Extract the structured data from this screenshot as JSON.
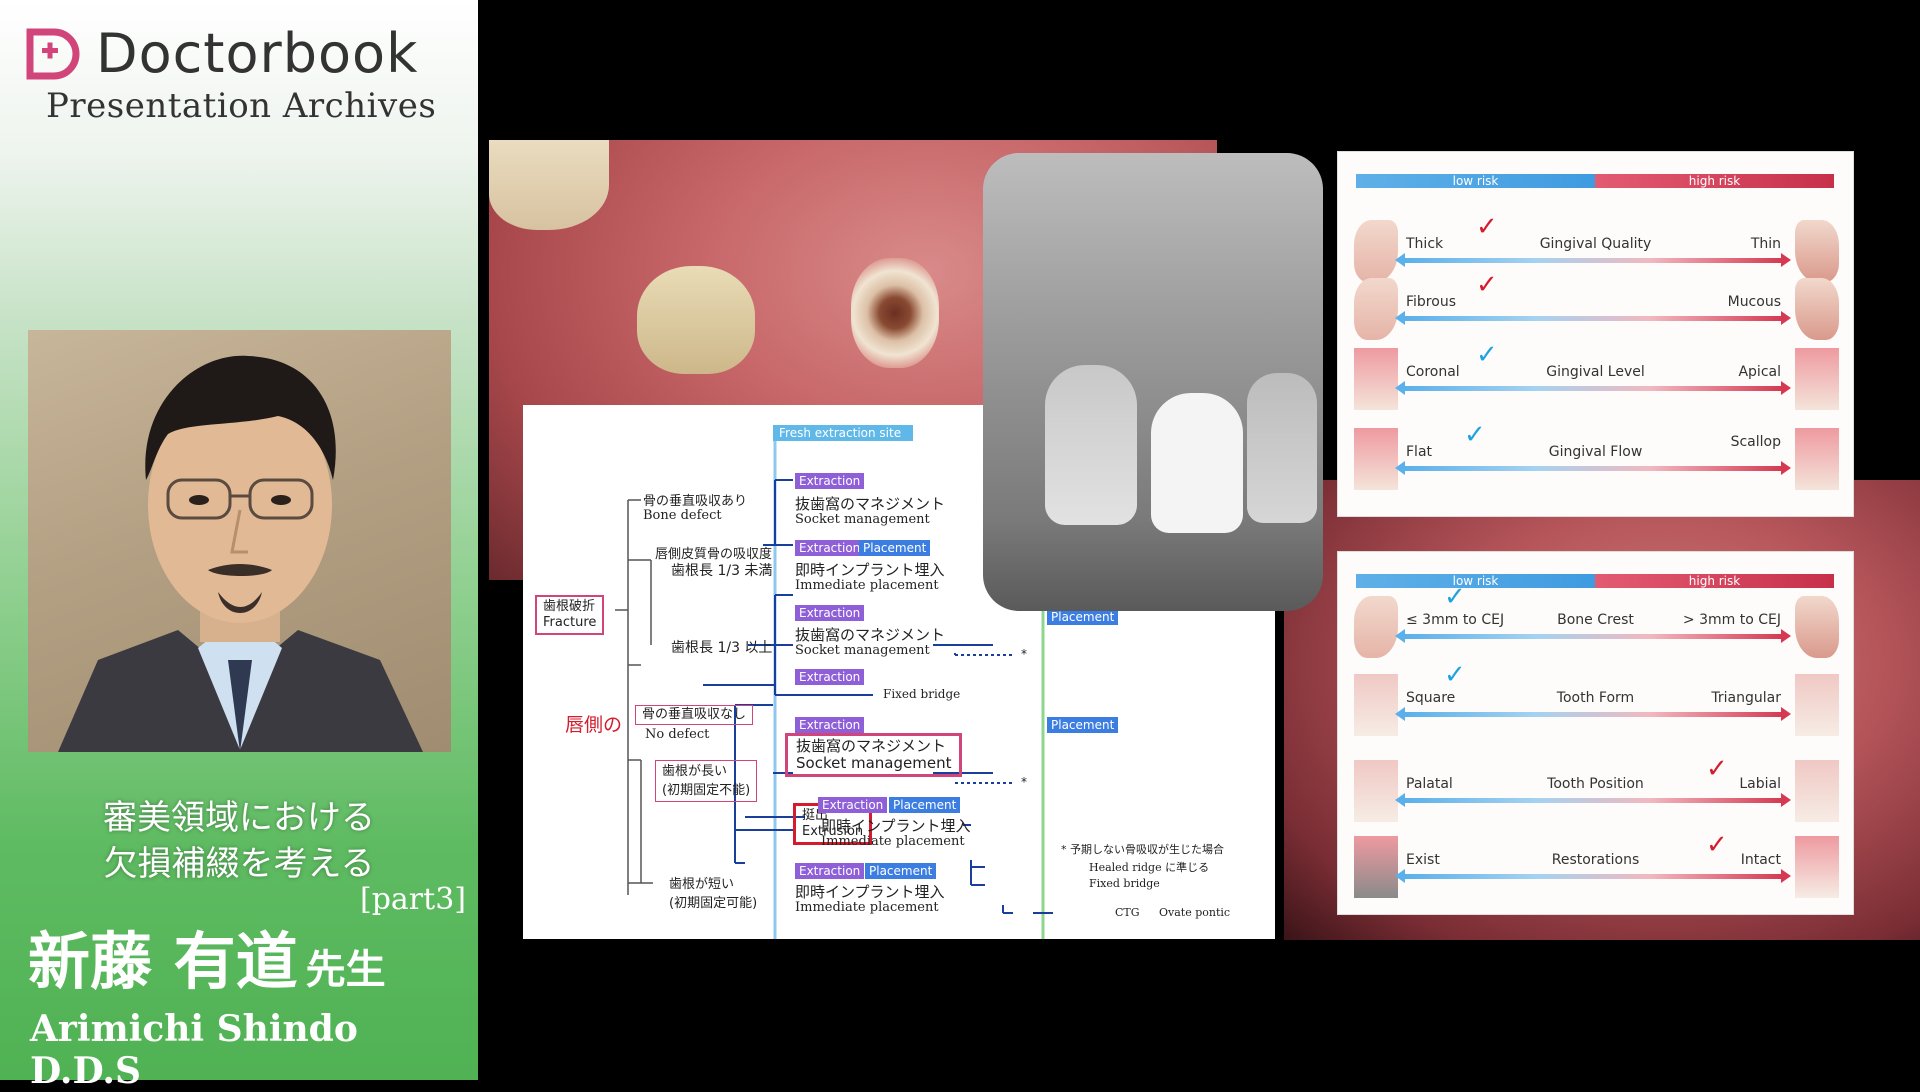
{
  "sidebar": {
    "brand": "Doctorbook",
    "subtitle": "Presentation Archives",
    "talk_title_line1": "審美領域における",
    "talk_title_line2": "欠損補綴を考える",
    "part": "[part3]",
    "speaker_name_jp": "新藤 有道",
    "speaker_honorific": "先生",
    "speaker_name_en": "Arimichi Shindo D.D.S"
  },
  "flowchart": {
    "header": "Fresh extraction site",
    "root_jp": "歯根破折",
    "root_en": "Fracture",
    "bone_defect_jp": "骨の垂直吸収あり",
    "bone_defect_en": "Bone defect",
    "labial_resorption_jp": "唇側皮質骨の吸収度",
    "root_len_lt": "歯根長 1/3 未満",
    "root_len_ge": "歯根長 1/3 以上",
    "labial_side": "唇側の",
    "no_defect_jp": "骨の垂直吸収なし",
    "no_defect_en": "No defect",
    "root_long": "歯根が長い",
    "initial_fixation_no": "(初期固定不能)",
    "root_short": "歯根が短い",
    "initial_fixation_yes": "(初期固定可能)",
    "extrusion_jp": "挺出",
    "extrusion_en": "Extrusion",
    "tag_extraction": "Extraction",
    "tag_placement": "Placement",
    "socket_mgmt_jp": "抜歯窩のマネジメント",
    "socket_mgmt_en": "Socket management",
    "immediate_jp": "即時インプラント埋入",
    "immediate_en": "Immediate placement",
    "fixed_bridge": "Fixed bridge",
    "note_jp": "* 予期しない骨吸収が生じた場合",
    "healed_ridge": "Healed ridge に準じる",
    "fixed_bridge2": "Fixed bridge",
    "ctg": "CTG",
    "ovate": "Ovate pontic",
    "asterisk": "*"
  },
  "chart_top": {
    "low": "low risk",
    "high": "high risk",
    "rows": [
      {
        "left": "Thick",
        "center": "Gingival Quality",
        "right": "Thin",
        "mark": "left-red"
      },
      {
        "left": "Fibrous",
        "center": "",
        "right": "Mucous",
        "mark": "left-red"
      },
      {
        "left": "Coronal",
        "center": "Gingival Level",
        "right": "Apical",
        "mark": "left-blue"
      },
      {
        "left": "Flat",
        "center": "Gingival Flow",
        "right": "Scallop",
        "mark": "left-blue"
      }
    ]
  },
  "chart_bottom": {
    "low": "low risk",
    "high": "high risk",
    "rows": [
      {
        "left": "≤ 3mm to CEJ",
        "center": "Bone Crest",
        "right": "> 3mm to CEJ",
        "mark": "left-blue"
      },
      {
        "left": "Square",
        "center": "Tooth Form",
        "right": "Triangular",
        "mark": "left-blue"
      },
      {
        "left": "Palatal",
        "center": "Tooth  Position",
        "right": "Labial",
        "mark": "right-red"
      },
      {
        "left": "Exist",
        "center": "Restorations",
        "right": "Intact",
        "mark": "right-red"
      }
    ]
  },
  "colors": {
    "brand_pink": "#d2457a",
    "low_risk": "#3f9be0",
    "high_risk": "#c7304a",
    "check_red": "#d41c2e",
    "check_blue": "#1fa3e0"
  }
}
